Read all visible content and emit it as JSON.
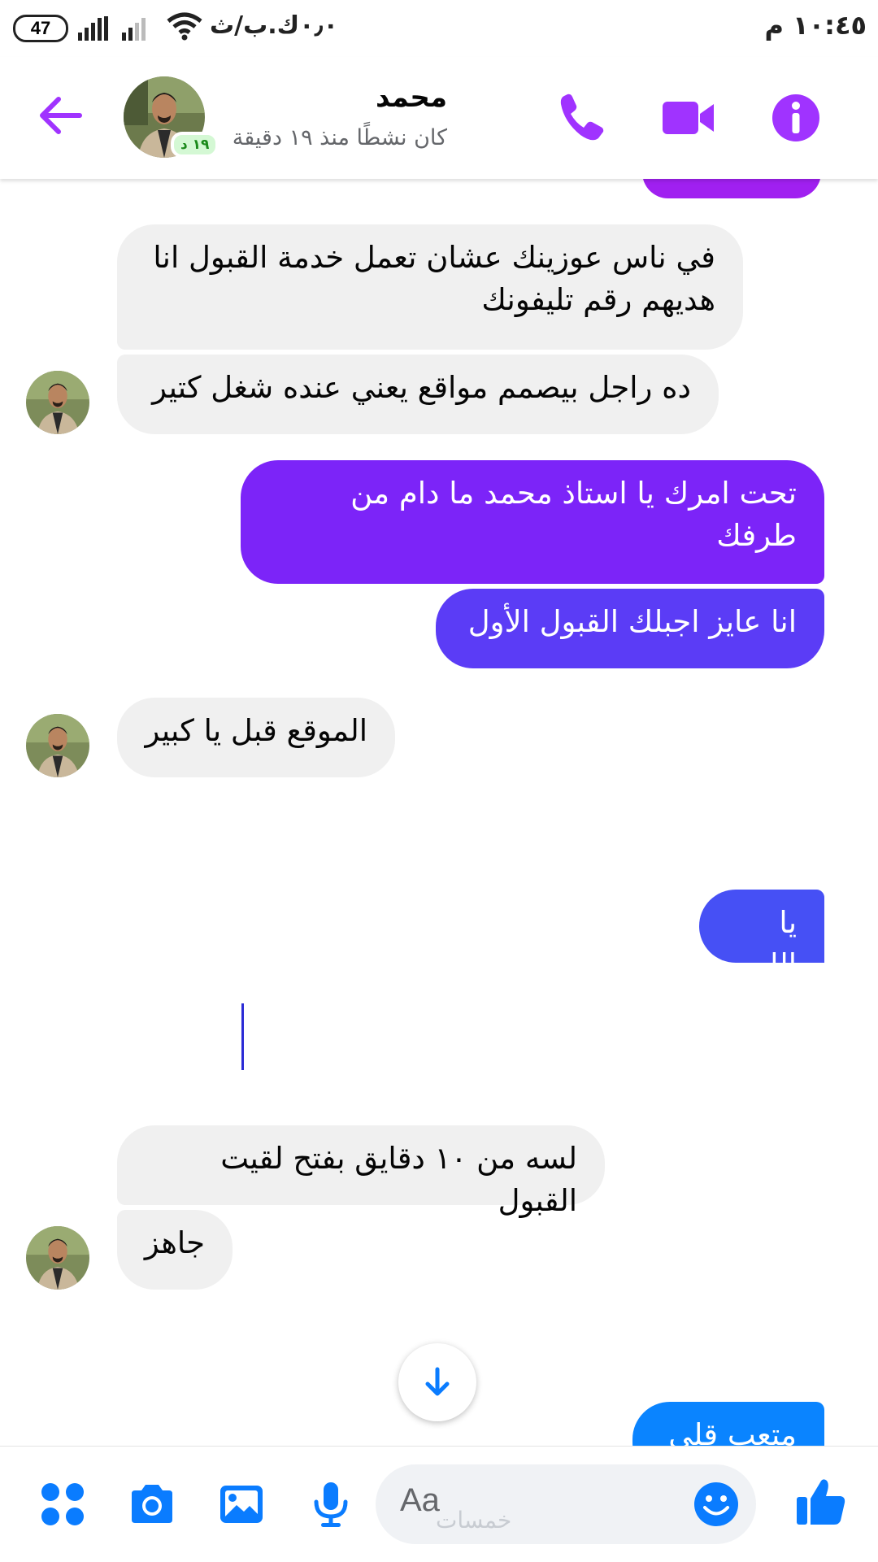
{
  "status_bar": {
    "battery": "47",
    "network_text": "٠٫٠ك.ب/ث",
    "time": "١٠:٤٥ م"
  },
  "header": {
    "contact_name": "محمد",
    "active_status": "كان نشطًا منذ ١٩ دقيقة",
    "active_badge": "١٩ د",
    "icons": [
      "back-arrow-icon",
      "phone-icon",
      "video-camera-icon",
      "info-icon"
    ],
    "accent_color": "#a033ff"
  },
  "messages": [
    {
      "side": "incoming",
      "text": "في ناس عوزينك عشان تعمل خدمة القبول انا\nهديهم رقم تليفونك"
    },
    {
      "side": "incoming",
      "text": "ده راجل بيصمم مواقع يعني عنده شغل كتير"
    },
    {
      "side": "outgoing",
      "text": "تحت امرك يا استاذ محمد ما دام من\nطرفك"
    },
    {
      "side": "outgoing",
      "text": "انا عايز اجبلك القبول الأول"
    },
    {
      "side": "incoming",
      "text": "الموقع قبل يا كبير"
    },
    {
      "side": "outgoing",
      "text": "يا الله"
    },
    {
      "side": "incoming",
      "text": "لسه من ١٠ دقايق بفتح لقيت القبول"
    },
    {
      "side": "incoming",
      "text": "جاهز"
    },
    {
      "side": "outgoing",
      "text": "متعب قلي"
    }
  ],
  "composer": {
    "placeholder": "Aa",
    "watermark": "خمسات",
    "icons": [
      "apps-grid-icon",
      "camera-icon",
      "gallery-icon",
      "microphone-icon",
      "emoji-icon",
      "thumbs-up-icon"
    ],
    "icon_color": "#0a7cff"
  },
  "colors": {
    "outgoing_top": "#8a1cff",
    "outgoing_mid": "#6b2cf5",
    "outgoing_low": "#3d5cf5",
    "outgoing_bottom": "#0a84ff",
    "incoming_bg": "#f0f0f0"
  }
}
